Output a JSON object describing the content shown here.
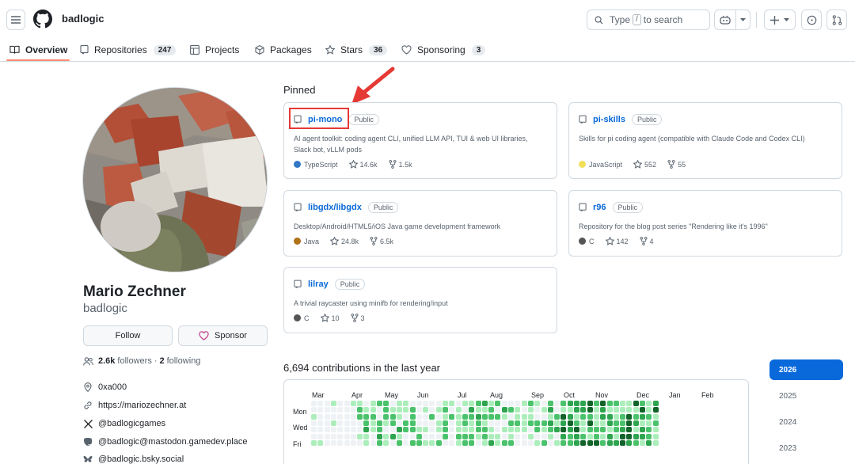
{
  "header": {
    "username": "badlogic",
    "search": {
      "prefix": "Type",
      "key": "/",
      "suffix": "to search"
    }
  },
  "tabs": [
    {
      "label": "Overview",
      "count": "",
      "icon": "book-icon"
    },
    {
      "label": "Repositories",
      "count": "247",
      "icon": "repo-icon"
    },
    {
      "label": "Projects",
      "count": "",
      "icon": "table-icon"
    },
    {
      "label": "Packages",
      "count": "",
      "icon": "package-icon"
    },
    {
      "label": "Stars",
      "count": "36",
      "icon": "star-icon"
    },
    {
      "label": "Sponsoring",
      "count": "3",
      "icon": "heart-icon"
    }
  ],
  "profile": {
    "full_name": "Mario Zechner",
    "login": "badlogic",
    "follow_label": "Follow",
    "sponsor_label": "Sponsor",
    "followers_count": "2.6k",
    "followers_label": "followers",
    "separator": "·",
    "following_count": "2",
    "following_label": "following",
    "details": [
      {
        "icon": "location-icon",
        "text": "0xa000"
      },
      {
        "icon": "link-icon",
        "text": "https://mariozechner.at"
      },
      {
        "icon": "x-logo-icon",
        "text": "@badlogicgames"
      },
      {
        "icon": "mastodon-icon",
        "text": "@badlogic@mastodon.gamedev.place"
      },
      {
        "icon": "bluesky-icon",
        "text": "@badlogic.bsky.social"
      }
    ]
  },
  "pinned": {
    "title": "Pinned",
    "repos": [
      {
        "name": "pi-mono",
        "badge": "Public",
        "desc": "AI agent toolkit: coding agent CLI, unified LLM API, TUI & web UI libraries, Slack bot, vLLM pods",
        "lang": "TypeScript",
        "lang_color": "#3178c6",
        "stars": "14.6k",
        "forks": "1.5k"
      },
      {
        "name": "pi-skills",
        "badge": "Public",
        "desc": "Skills for pi coding agent (compatible with Claude Code and Codex CLI)",
        "lang": "JavaScript",
        "lang_color": "#f1e05a",
        "stars": "552",
        "forks": "55"
      },
      {
        "name": "libgdx/libgdx",
        "badge": "Public",
        "desc": "Desktop/Android/HTML5/iOS Java game development framework",
        "lang": "Java",
        "lang_color": "#b07219",
        "stars": "24.8k",
        "forks": "6.5k"
      },
      {
        "name": "r96",
        "badge": "Public",
        "desc": "Repository for the blog post series \"Rendering like it's 1996\"",
        "lang": "C",
        "lang_color": "#555555",
        "stars": "142",
        "forks": "4"
      },
      {
        "name": "lilray",
        "badge": "Public",
        "desc": "A trivial raycaster using minifb for rendering/input",
        "lang": "C",
        "lang_color": "#555555",
        "stars": "10",
        "forks": "3"
      }
    ]
  },
  "contributions": {
    "title": "6,694 contributions in the last year",
    "months": [
      "Mar",
      "Apr",
      "May",
      "Jun",
      "Jul",
      "Aug",
      "Sep",
      "Oct",
      "Nov",
      "Dec",
      "Jan",
      "Feb"
    ],
    "day_labels": [
      "Mon",
      "Wed",
      "Fri"
    ],
    "colors": [
      "#eff2f5",
      "#aceebb",
      "#4ac26b",
      "#2da44e",
      "#116329"
    ]
  },
  "years": [
    "2026",
    "2025",
    "2024",
    "2023"
  ]
}
